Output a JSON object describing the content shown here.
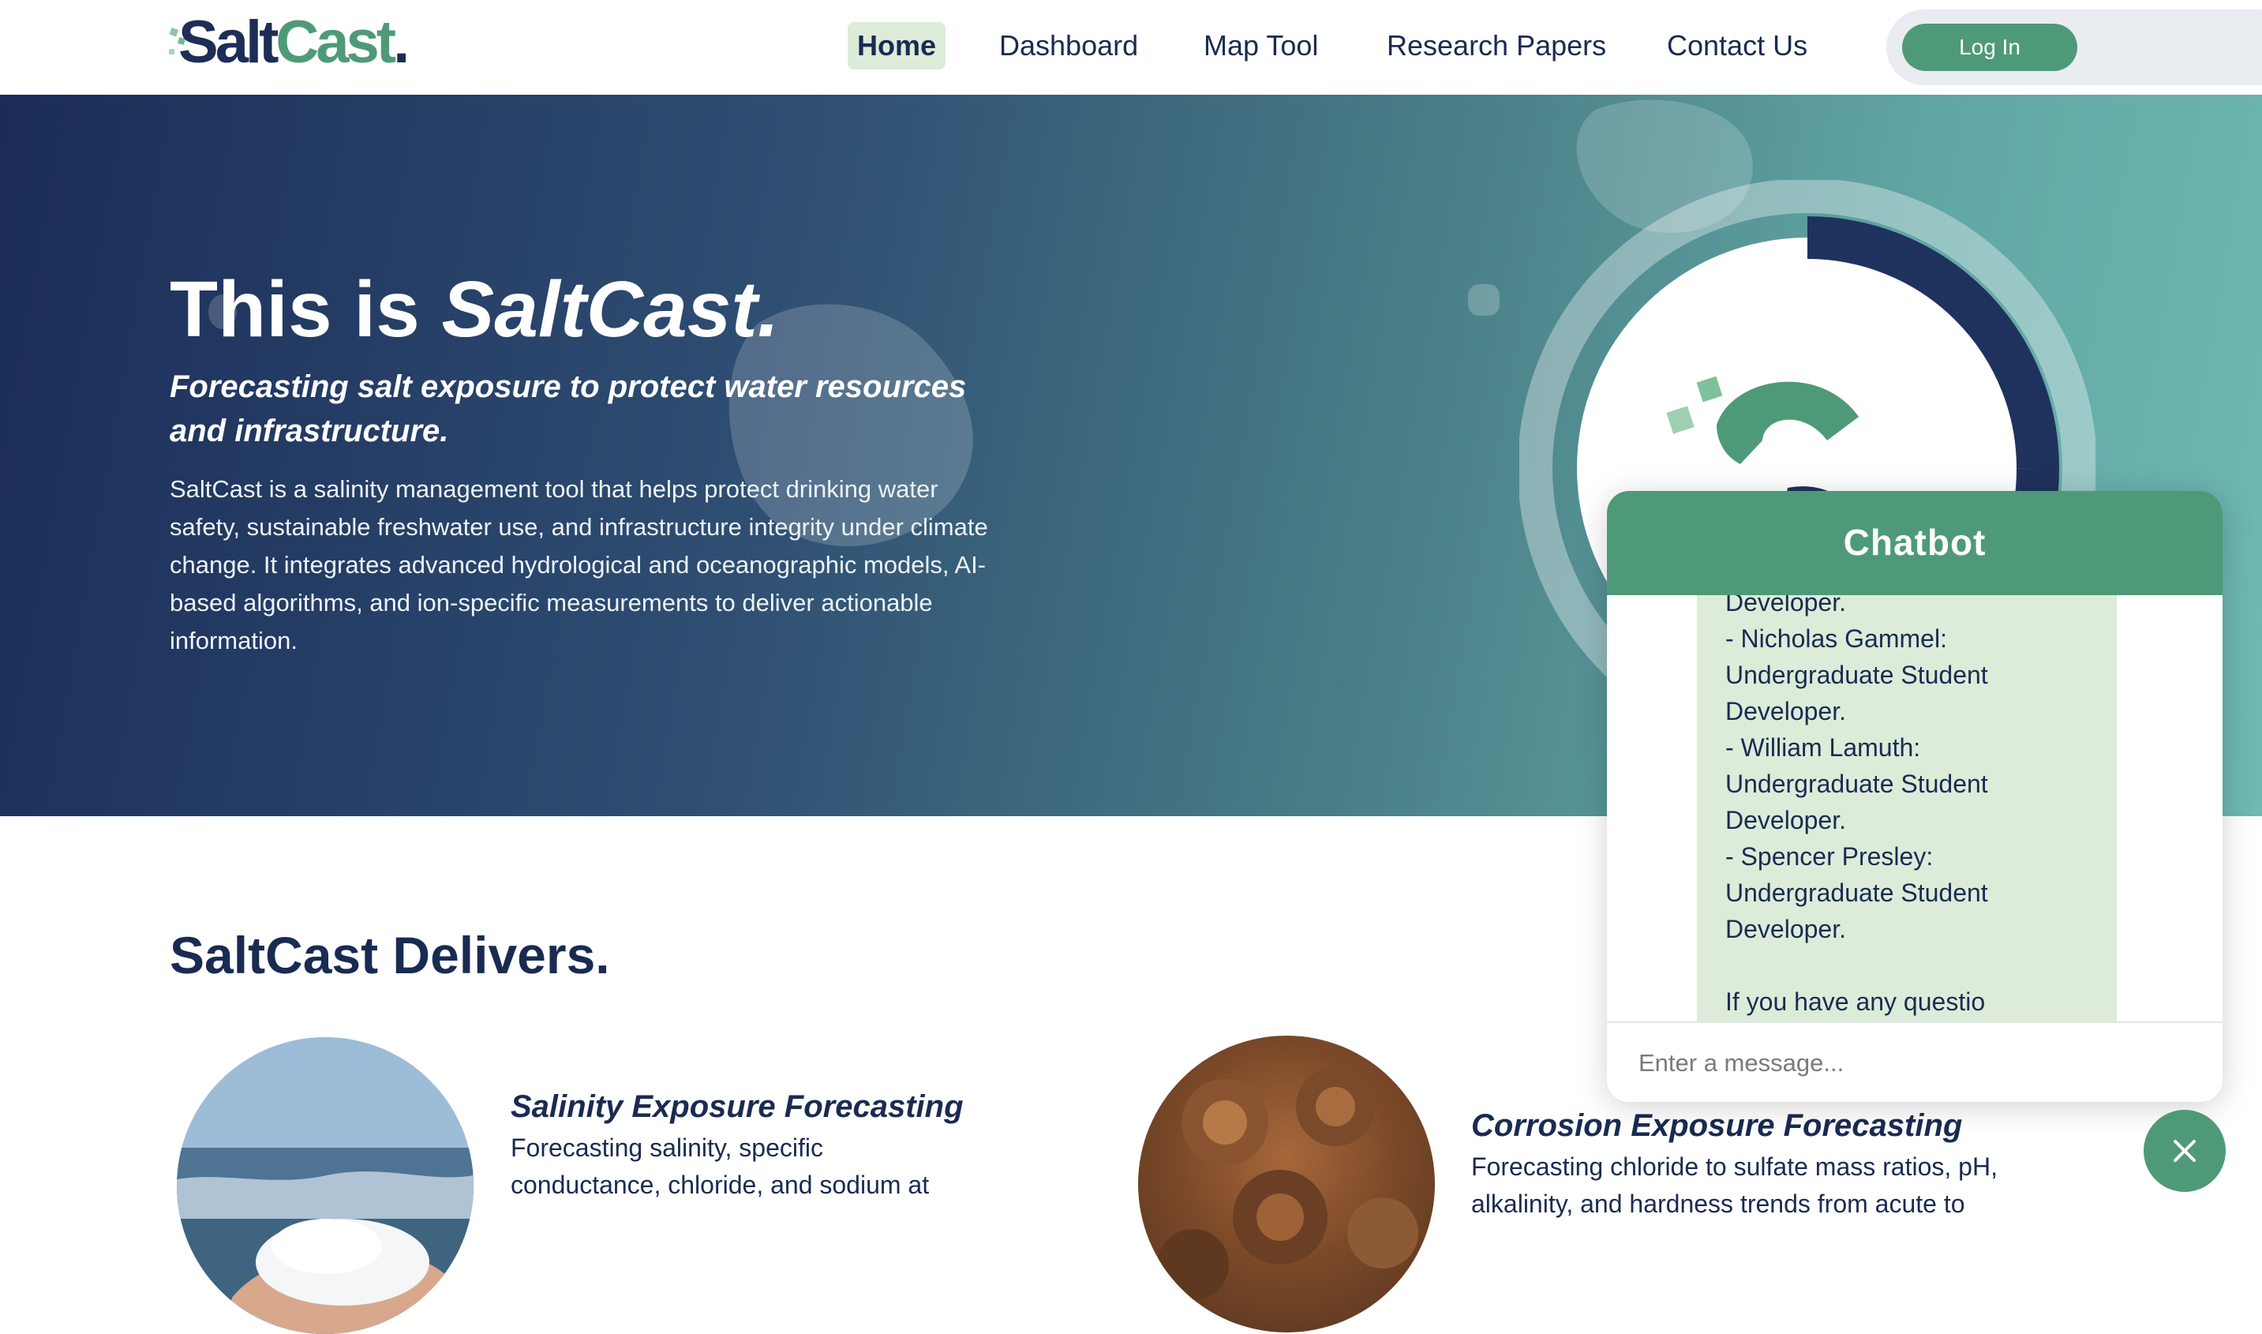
{
  "brand": {
    "name_part1": "Salt",
    "name_part2": "Cast",
    "name_period": "."
  },
  "nav": {
    "items": [
      "Home",
      "Dashboard",
      "Map Tool",
      "Research Papers",
      "Contact Us"
    ],
    "login_label": "Log In"
  },
  "hero": {
    "title_prefix": "This is ",
    "title_emphasis": "SaltCast.",
    "subtitle": "Forecasting salt exposure to protect water resources and infrastructure.",
    "body": "SaltCast is a salinity management tool that helps protect drinking water safety, sustainable freshwater use, and infrastructure integrity under climate change. It integrates advanced hydrological and oceanographic models, AI-based algorithms, and ion-specific measurements to deliver actionable information."
  },
  "delivers": {
    "title": "SaltCast Delivers.",
    "cards": [
      {
        "title": "Salinity Exposure Forecasting",
        "text_lines": [
          "Forecasting salinity, specific",
          "conductance, chloride, and sodium at"
        ]
      },
      {
        "title": "Corrosion Exposure Forecasting",
        "text_lines": [
          "Forecasting chloride to sulfate mass ratios, pH,",
          "alkalinity, and hardness trends from acute to"
        ]
      }
    ]
  },
  "chatbot": {
    "title": "Chatbot",
    "message_lines": [
      "Developer.",
      "- Nicholas Gammel:",
      "Undergraduate Student",
      "Developer.",
      "- William Lamuth:",
      "Undergraduate Student",
      "Developer.",
      "- Spencer Presley:",
      "Undergraduate Student",
      "Developer.",
      "",
      "If you have any questio"
    ],
    "input_placeholder": "Enter a message..."
  },
  "icons": [
    "saltcast-logo-icon",
    "close-icon"
  ],
  "colors": {
    "navy": "#1a2b52",
    "green": "#4e9a78",
    "light_green": "#dcecd8",
    "teal": "#6fb8b3"
  }
}
